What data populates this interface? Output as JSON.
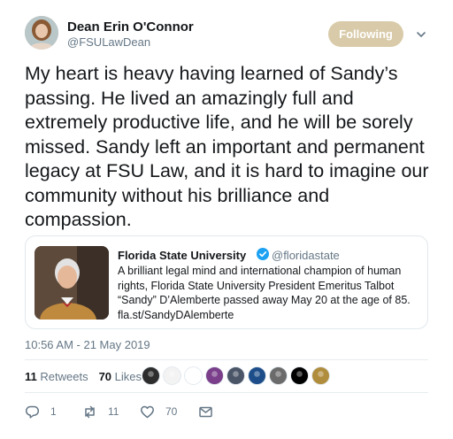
{
  "author": {
    "name": "Dean Erin O'Connor",
    "handle": "@FSULawDean",
    "avatar_icon": "profile-photo"
  },
  "follow_button": {
    "label": "Following",
    "color": "#d9cba9"
  },
  "tweet": {
    "text": "My heart is heavy having learned of Sandy’s passing. He lived an amazingly full and extremely productive life, and he will be sorely missed. Sandy left an important and permanent legacy at FSU Law, and it is hard to imagine our community without his brilliance and compassion.",
    "timestamp": "10:56 AM - 21 May 2019"
  },
  "quoted_tweet": {
    "name": "Florida State University",
    "handle": "@floridastate",
    "verified": true,
    "text": "A brilliant legal mind and international champion of human rights, Florida State University President Emeritus Talbot “Sandy” D’Alemberte passed away May 20 at the age of 85. fla.st/SandyDAlemberte"
  },
  "stats": {
    "retweets_count": "11",
    "retweets_label": "Retweets",
    "likes_count": "70",
    "likes_label": "Likes"
  },
  "likers": [
    {
      "icon": "avatar-1",
      "color": "#2d2d2d"
    },
    {
      "icon": "avatar-2",
      "color": "#f3f3f3"
    },
    {
      "icon": "avatar-3",
      "color": "#ffffff"
    },
    {
      "icon": "avatar-4",
      "color": "#7a3e8a"
    },
    {
      "icon": "avatar-5",
      "color": "#4a5568"
    },
    {
      "icon": "avatar-6",
      "color": "#1d4e89"
    },
    {
      "icon": "avatar-7",
      "color": "#6b6b6b"
    },
    {
      "icon": "avatar-8",
      "color": "#000000"
    },
    {
      "icon": "avatar-9",
      "color": "#b08d3c"
    }
  ],
  "actions": {
    "reply_count": "1",
    "retweet_count": "11",
    "like_count": "70"
  },
  "colors": {
    "text": "#14171a",
    "secondary": "#657786",
    "border": "#e1e8ed",
    "verified": "#1da1f2"
  }
}
